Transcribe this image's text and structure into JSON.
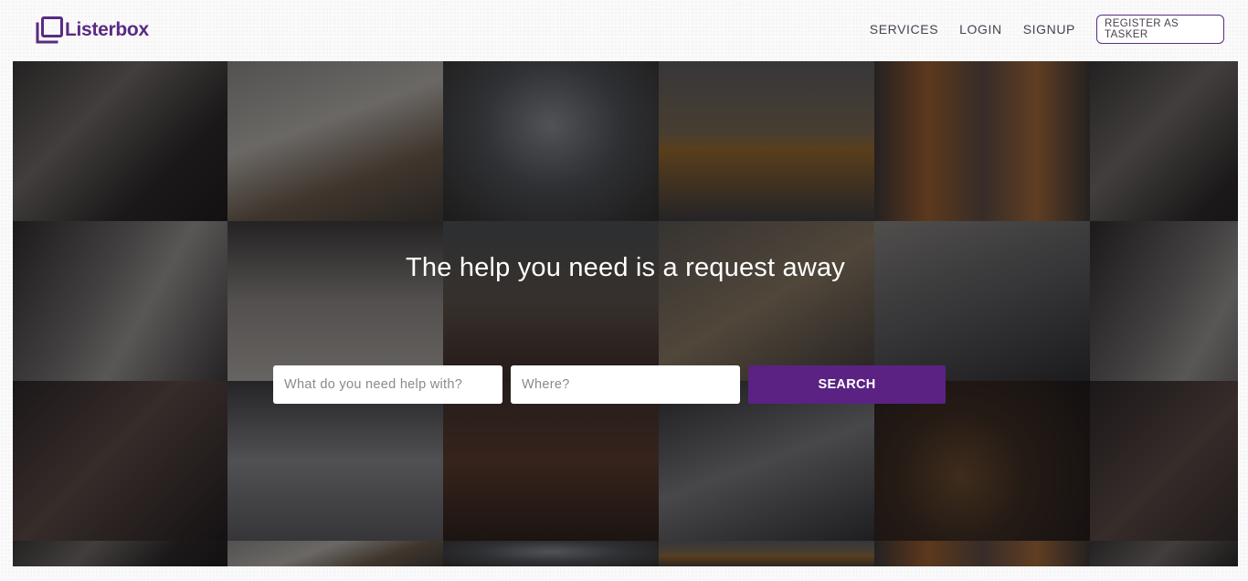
{
  "header": {
    "logo_text": "Listerbox",
    "logo_icon": "stacked-squares-logo-icon",
    "nav": {
      "services": "SERVICES",
      "login": "LOGIN",
      "signup": "SIGNUP",
      "register": "REGISTER AS TASKER"
    }
  },
  "hero": {
    "title": "The help you need is a request away",
    "background_tiles": [
      "chef-in-kitchen",
      "tools-on-table",
      "hallway-interior",
      "orange-delivery-van",
      "paint-rollers",
      "chef-in-kitchen",
      "stacked-dishes",
      "clothes-on-rack",
      "person-cleaning-floor",
      "boxes-table",
      "gloved-hand",
      "stacked-dishes",
      "hand-with-device",
      "iron-and-cloth",
      "wooden-floor",
      "faucet-water",
      "food-plate",
      "hand-with-device"
    ],
    "search": {
      "what_placeholder": "What do you need help with?",
      "where_placeholder": "Where?",
      "button_label": "SEARCH"
    }
  },
  "colors": {
    "brand_purple": "#5b2283",
    "text_dark": "#4a4050",
    "white": "#ffffff"
  }
}
